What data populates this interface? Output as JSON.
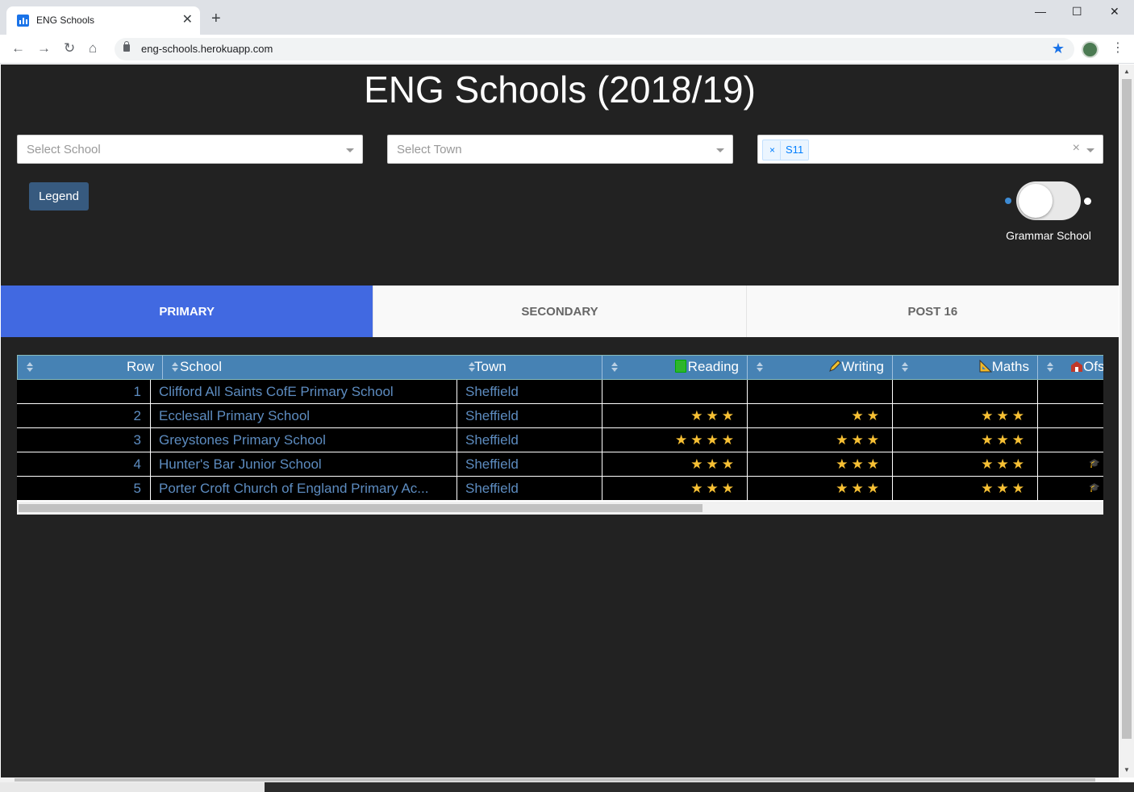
{
  "browser": {
    "tab_title": "ENG Schools",
    "tab_close": "✕",
    "new_tab": "+",
    "url": "eng-schools.herokuapp.com",
    "window_controls": [
      "—",
      "☐",
      "✕"
    ],
    "nav": {
      "back": "←",
      "forward": "→",
      "reload": "↻",
      "home": "⌂"
    },
    "bookmark_icon": "★",
    "menu_icon": "⋮"
  },
  "page": {
    "title": "ENG Schools (2018/19)",
    "filters": {
      "school_placeholder": "Select School",
      "town_placeholder": "Select Town",
      "postcode_chip": "S11",
      "chip_remove": "×",
      "clear": "×"
    },
    "legend_button": "Legend",
    "grammar_toggle_label": "Grammar School",
    "grammar_toggle_on": false,
    "tabs": [
      {
        "label": "PRIMARY",
        "active": true
      },
      {
        "label": "SECONDARY",
        "active": false
      },
      {
        "label": "POST 16",
        "active": false
      }
    ],
    "table": {
      "headers": {
        "row": "Row",
        "school": "School",
        "town": "Town",
        "reading": "Reading",
        "writing": "Writing",
        "maths": "Maths",
        "ofsted": "Ofs"
      },
      "rows": [
        {
          "row": "1",
          "school": "Clifford All Saints CofE Primary School",
          "town": "Sheffield",
          "reading": "",
          "writing": "",
          "maths": "",
          "ofsted": ""
        },
        {
          "row": "2",
          "school": "Ecclesall Primary School",
          "town": "Sheffield",
          "reading": "★★★",
          "writing": "★★",
          "maths": "★★★",
          "ofsted": ""
        },
        {
          "row": "3",
          "school": "Greystones Primary School",
          "town": "Sheffield",
          "reading": "★★★★",
          "writing": "★★★",
          "maths": "★★★",
          "ofsted": ""
        },
        {
          "row": "4",
          "school": "Hunter's Bar Junior School",
          "town": "Sheffield",
          "reading": "★★★",
          "writing": "★★★",
          "maths": "★★★",
          "ofsted": "🎓"
        },
        {
          "row": "5",
          "school": "Porter Croft Church of England Primary Ac...",
          "town": "Sheffield",
          "reading": "★★★",
          "writing": "★★★",
          "maths": "★★★",
          "ofsted": "🎓"
        }
      ]
    }
  },
  "colors": {
    "page_bg": "#222222",
    "active_tab": "#4169e1",
    "header_bg": "#4682b4",
    "link": "#5d8cc0",
    "star": "#f7c034",
    "legend_btn": "#375a7f"
  }
}
